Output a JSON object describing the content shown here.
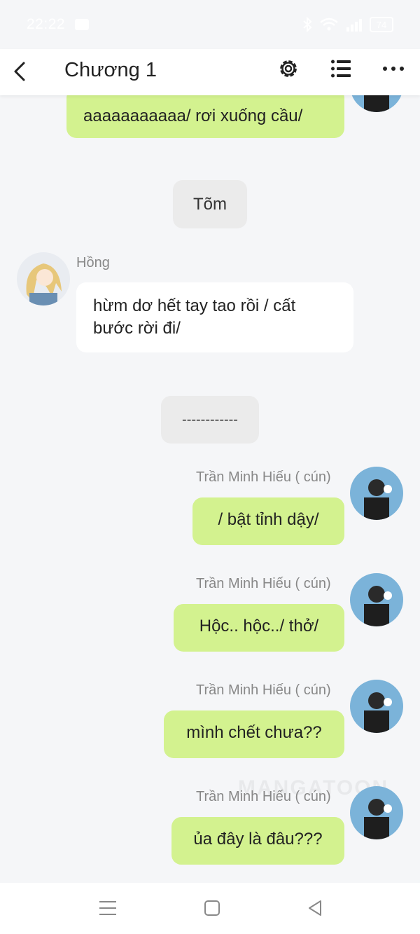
{
  "status_bar": {
    "time": "22:22",
    "battery": "74"
  },
  "header": {
    "title": "Chương 1"
  },
  "messages": [
    {
      "text": "aaaaaaaaaaa/ rơi xuống cầu/"
    },
    {
      "text": "Tõm"
    },
    {
      "sender": "Hồng",
      "line1": "hừm dơ hết tay tao rồi / cất",
      "line2": "bước rời đi/"
    },
    {
      "text": "------------"
    },
    {
      "sender": "Trần Minh Hiếu ( cún)",
      "text": "/ bật tỉnh dậy/"
    },
    {
      "sender": "Trần Minh Hiếu ( cún)",
      "text": "Hộc.. hộc../ thở/"
    },
    {
      "sender": "Trần Minh Hiếu ( cún)",
      "text": "mình chết chưa??"
    },
    {
      "sender": "Trần Minh Hiếu ( cún)",
      "text": "ủa đây là đâu???"
    }
  ],
  "watermark": "MANGATOON",
  "colors": {
    "right_bubble": "#d3f28f",
    "left_bubble": "#ffffff",
    "narration": "#ebebeb",
    "background": "#f5f6f8"
  },
  "icons": {
    "back": "chevron-left-icon",
    "settings": "gear-icon",
    "list": "list-icon",
    "more": "more-dots-icon"
  }
}
